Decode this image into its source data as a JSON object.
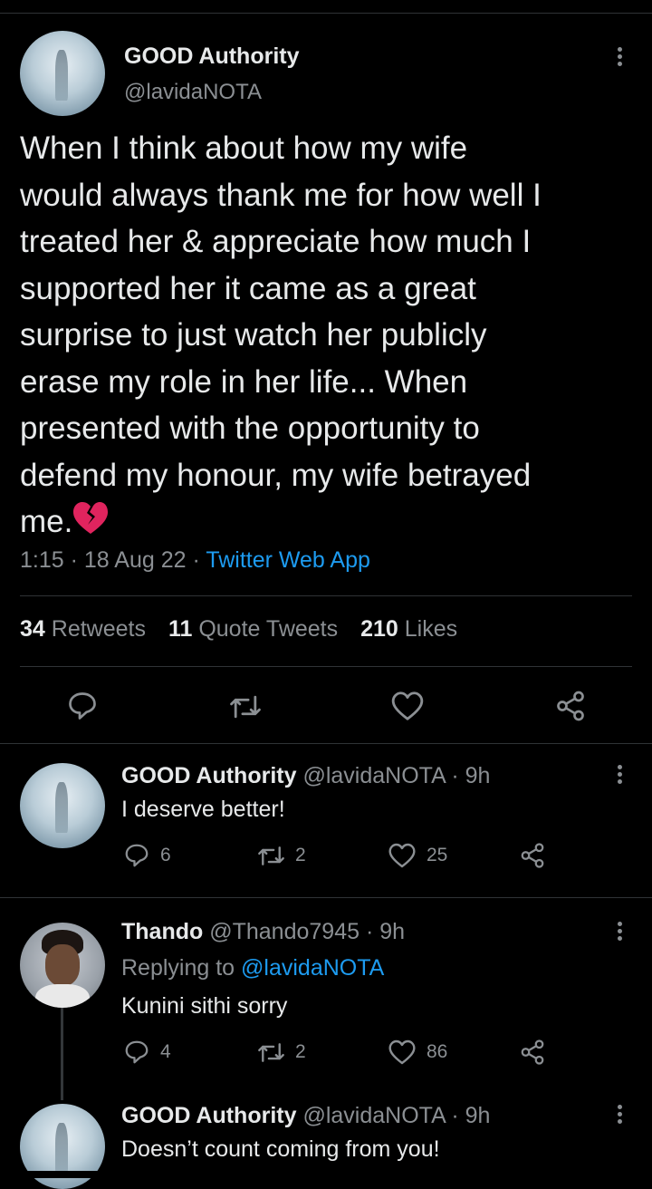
{
  "tweet": {
    "author_name": "GOOD Authority",
    "author_handle": "@lavidaNOTA",
    "text": "When I think about how my wife\nwould always thank me for how well I\ntreated her & appreciate how much I\nsupported her it came as a great\nsurprise to just watch her publicly\nerase my role in her life... When\npresented with the opportunity to\ndefend my honour, my wife betrayed\nme.",
    "emoji": "broken-heart",
    "time": "1:15",
    "date": "18 Aug 22",
    "separator": "·",
    "source": "Twitter Web App",
    "stats": {
      "retweets_count": "34",
      "retweets_label": "Retweets",
      "quotes_count": "11",
      "quotes_label": "Quote Tweets",
      "likes_count": "210",
      "likes_label": "Likes"
    }
  },
  "replies": [
    {
      "author_name": "GOOD Authority",
      "author_handle": "@lavidaNOTA",
      "time": "· 9h",
      "text": "I deserve better!",
      "reply_count": "6",
      "retweet_count": "2",
      "like_count": "25"
    },
    {
      "author_name": "Thando",
      "author_handle": "@Thando7945",
      "time": "· 9h",
      "replying_to_label": "Replying to",
      "replying_to_handle": "@lavidaNOTA",
      "text": "Kunini sithi sorry",
      "reply_count": "4",
      "retweet_count": "2",
      "like_count": "86"
    },
    {
      "author_name": "GOOD Authority",
      "author_handle": "@lavidaNOTA",
      "time": "· 9h",
      "text": "Doesn’t count coming from you!"
    }
  ],
  "colors": {
    "background": "#000000",
    "text": "#e7e9ea",
    "muted": "#71767b",
    "link": "#1d9bf0",
    "divider": "#2f3336",
    "heart_emoji": "#e0245e"
  }
}
